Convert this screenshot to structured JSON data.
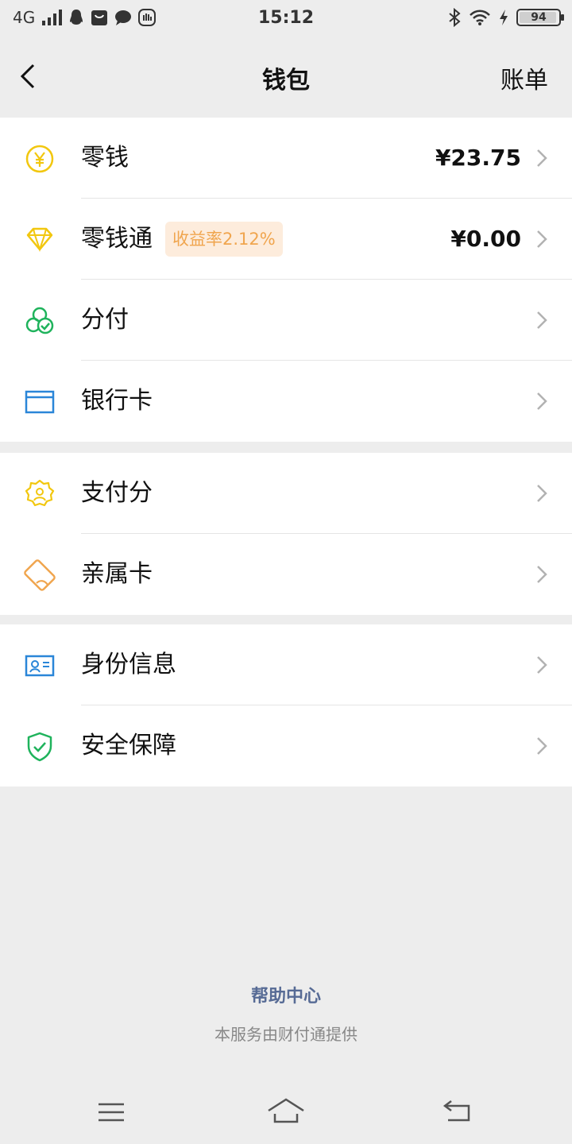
{
  "status_bar": {
    "network": "4G",
    "time": "15:12",
    "battery": "94"
  },
  "nav": {
    "title": "钱包",
    "right_action": "账单"
  },
  "groups": [
    {
      "items": [
        {
          "label": "零钱",
          "amount": "¥23.75",
          "icon": "yuan-coin-icon",
          "color": "#f2c70f"
        },
        {
          "label": "零钱通",
          "badge": "收益率2.12%",
          "amount": "¥0.00",
          "icon": "diamond-icon",
          "color": "#f2c70f"
        },
        {
          "label": "分付",
          "icon": "circles-check-icon",
          "color": "#1fb35c"
        },
        {
          "label": "银行卡",
          "icon": "bank-card-icon",
          "color": "#2a86d8"
        }
      ]
    },
    {
      "items": [
        {
          "label": "支付分",
          "icon": "score-badge-icon",
          "color": "#f2c70f"
        },
        {
          "label": "亲属卡",
          "icon": "family-card-icon",
          "color": "#f0a54e"
        }
      ]
    },
    {
      "items": [
        {
          "label": "身份信息",
          "icon": "id-card-icon",
          "color": "#2a86d8"
        },
        {
          "label": "安全保障",
          "icon": "shield-check-icon",
          "color": "#1fb35c"
        }
      ]
    }
  ],
  "footer": {
    "help": "帮助中心",
    "provider": "本服务由财付通提供"
  },
  "colors": {
    "background": "#ededed",
    "link": "#576b95",
    "badge_bg": "#fdecdc",
    "badge_text": "#f0a54e"
  }
}
